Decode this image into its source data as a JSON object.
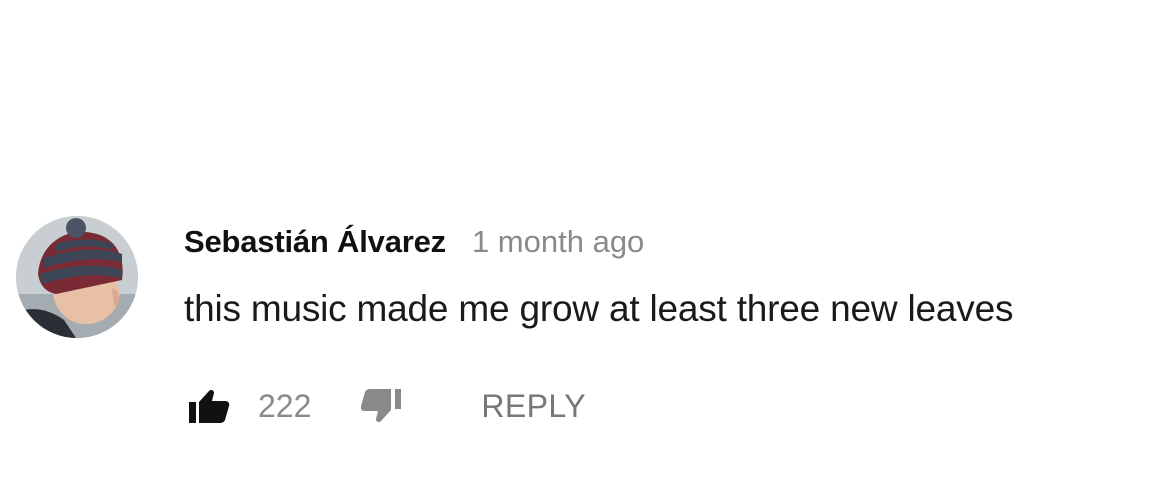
{
  "comment": {
    "author": "Sebastián Álvarez",
    "timestamp": "1 month ago",
    "text": "this music made me grow at least three new leaves",
    "avatar_icon": "user-avatar",
    "likes": "222",
    "like_icon": "thumbs-up-icon",
    "dislike_icon": "thumbs-down-icon",
    "reply_label": "REPLY"
  },
  "colors": {
    "author_text": "#111111",
    "meta_text": "#8a8a8a",
    "icon": "#111111",
    "icon_muted": "#8a8a8a"
  }
}
